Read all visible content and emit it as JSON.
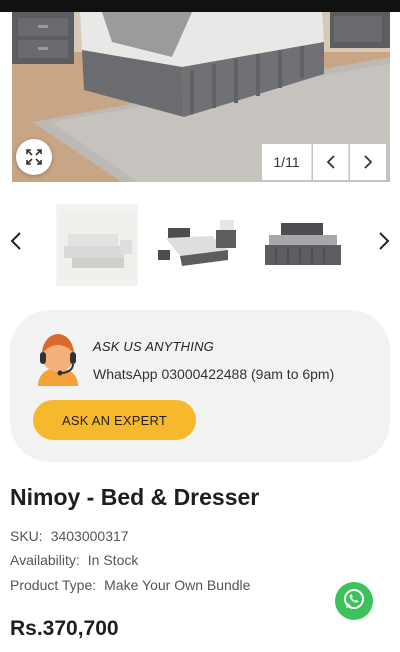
{
  "gallery": {
    "counter": "1/11",
    "icons": {
      "zoom": "expand-arrows-icon",
      "prev": "chevron-left-icon",
      "next": "chevron-right-icon"
    }
  },
  "thumbnails": {
    "items": [
      {
        "alt": "white bed room thumbnail"
      },
      {
        "alt": "grey bed with dresser thumbnail"
      },
      {
        "alt": "grey bed front thumbnail"
      }
    ]
  },
  "ask": {
    "title": "ASK US ANYTHING",
    "phone": "WhatsApp 03000422488 (9am to 6pm)",
    "button_label": "ASK AN EXPERT",
    "accent_color": "#f6b92e"
  },
  "product": {
    "title": "Nimoy - Bed & Dresser",
    "sku_label": "SKU:",
    "sku_value": "3403000317",
    "availability_label": "Availability:",
    "availability_value": "In Stock",
    "type_label": "Product Type:",
    "type_value": "Make Your Own Bundle",
    "price": "Rs.370,700"
  },
  "whatsapp": {
    "color": "#3cc25a",
    "icon": "whatsapp-icon"
  }
}
